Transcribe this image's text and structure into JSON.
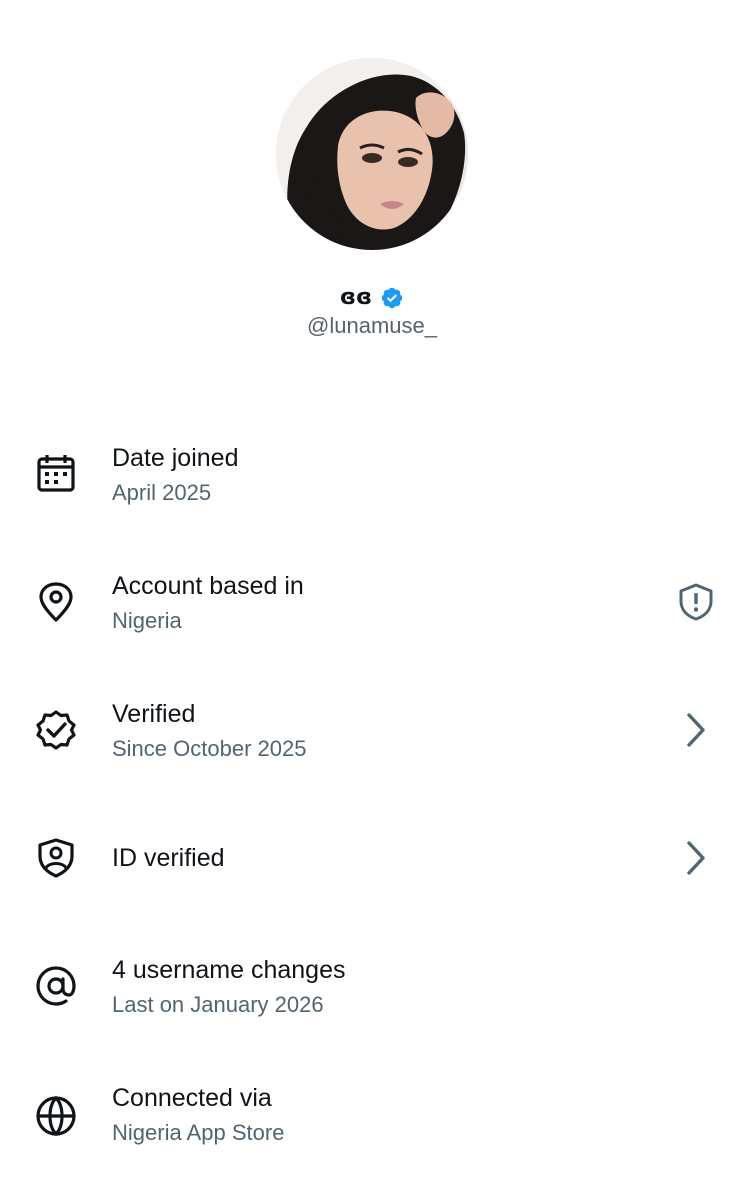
{
  "profile": {
    "display_name": "ɞɞ",
    "handle": "@lunamuse_",
    "verified_badge_icon": "verified-badge-icon",
    "badge_color": "#1d9bf0"
  },
  "rows": [
    {
      "icon": "calendar-icon",
      "title": "Date joined",
      "subtitle": "April 2025"
    },
    {
      "icon": "location-pin-icon",
      "title": "Account based in",
      "subtitle": "Nigeria",
      "right_icon": "shield-alert-icon"
    },
    {
      "icon": "verified-seal-icon",
      "title": "Verified",
      "subtitle": "Since October 2025",
      "right_icon": "chevron-right-icon"
    },
    {
      "icon": "id-shield-icon",
      "title": "ID verified",
      "right_icon": "chevron-right-icon"
    },
    {
      "icon": "at-sign-icon",
      "title": "4 username changes",
      "subtitle": "Last on January 2026"
    },
    {
      "icon": "globe-icon",
      "title": "Connected via",
      "subtitle": "Nigeria App Store"
    }
  ],
  "colors": {
    "primary_text": "#0f1419",
    "secondary_text": "#536471",
    "background": "#ffffff"
  }
}
